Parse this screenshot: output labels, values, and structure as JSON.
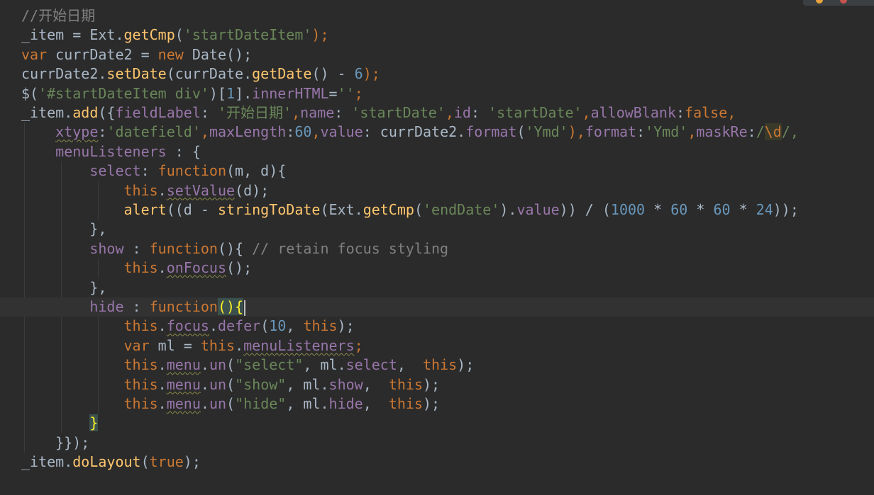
{
  "editor": {
    "lines": [
      {
        "tokens": [
          {
            "t": "//开始日期",
            "c": "comment"
          }
        ]
      },
      {
        "tokens": [
          {
            "t": "_item = Ext.",
            "c": "plain"
          },
          {
            "t": "getCmp",
            "c": "fn"
          },
          {
            "t": "(",
            "c": "plain"
          },
          {
            "t": "'startDateItem'",
            "c": "str"
          },
          {
            "t": ");",
            "c": "kw"
          }
        ]
      },
      {
        "tokens": [
          {
            "t": "var ",
            "c": "kw"
          },
          {
            "t": "currDate2 = ",
            "c": "plain"
          },
          {
            "t": "new ",
            "c": "kw"
          },
          {
            "t": "Date();",
            "c": "plain"
          }
        ]
      },
      {
        "tokens": [
          {
            "t": "currDate2.",
            "c": "plain"
          },
          {
            "t": "setDate",
            "c": "fn"
          },
          {
            "t": "(currDate.",
            "c": "plain"
          },
          {
            "t": "getDate",
            "c": "fn"
          },
          {
            "t": "() - ",
            "c": "plain"
          },
          {
            "t": "6",
            "c": "num"
          },
          {
            "t": ");",
            "c": "kw"
          }
        ]
      },
      {
        "tokens": [
          {
            "t": "$(",
            "c": "plain"
          },
          {
            "t": "'#startDateItem div'",
            "c": "str"
          },
          {
            "t": ")[",
            "c": "plain"
          },
          {
            "t": "1",
            "c": "num"
          },
          {
            "t": "].",
            "c": "plain"
          },
          {
            "t": "innerHTML",
            "c": "prop"
          },
          {
            "t": "=",
            "c": "plain"
          },
          {
            "t": "''",
            "c": "str"
          },
          {
            "t": ";",
            "c": "kw"
          }
        ]
      },
      {
        "tokens": [
          {
            "t": "_item.",
            "c": "plain"
          },
          {
            "t": "add",
            "c": "fn"
          },
          {
            "t": "({",
            "c": "plain"
          },
          {
            "t": "fieldLabel",
            "c": "prop"
          },
          {
            "t": ": ",
            "c": "plain"
          },
          {
            "t": "'开始日期'",
            "c": "str"
          },
          {
            "t": ",",
            "c": "kw"
          },
          {
            "t": "name",
            "c": "prop"
          },
          {
            "t": ": ",
            "c": "plain"
          },
          {
            "t": "'startDate'",
            "c": "str"
          },
          {
            "t": ",",
            "c": "kw"
          },
          {
            "t": "id",
            "c": "prop"
          },
          {
            "t": ": ",
            "c": "plain"
          },
          {
            "t": "'startDate'",
            "c": "str"
          },
          {
            "t": ",",
            "c": "kw"
          },
          {
            "t": "allowBlank",
            "c": "prop"
          },
          {
            "t": ":",
            "c": "plain"
          },
          {
            "t": "false",
            "c": "kw"
          },
          {
            "t": ",",
            "c": "kw"
          }
        ]
      },
      {
        "tokens": [
          {
            "t": "    ",
            "c": "plain"
          },
          {
            "t": "xtype",
            "c": "prop warn"
          },
          {
            "t": ":",
            "c": "plain"
          },
          {
            "t": "'datefield'",
            "c": "str"
          },
          {
            "t": ",",
            "c": "kw"
          },
          {
            "t": "maxLength",
            "c": "prop"
          },
          {
            "t": ":",
            "c": "plain"
          },
          {
            "t": "60",
            "c": "num"
          },
          {
            "t": ",",
            "c": "kw"
          },
          {
            "t": "value",
            "c": "prop"
          },
          {
            "t": ": currDate2.",
            "c": "plain"
          },
          {
            "t": "format",
            "c": "prop"
          },
          {
            "t": "(",
            "c": "plain"
          },
          {
            "t": "'Ymd'",
            "c": "str"
          },
          {
            "t": "),",
            "c": "kw"
          },
          {
            "t": "format",
            "c": "prop"
          },
          {
            "t": ":",
            "c": "plain"
          },
          {
            "t": "'Ymd'",
            "c": "str"
          },
          {
            "t": ",",
            "c": "kw"
          },
          {
            "t": "maskRe",
            "c": "prop"
          },
          {
            "t": ":",
            "c": "plain"
          },
          {
            "t": "/",
            "c": "str"
          },
          {
            "t": "\\d",
            "c": "esc"
          },
          {
            "t": "/,",
            "c": "str"
          }
        ]
      },
      {
        "tokens": [
          {
            "t": "    ",
            "c": "plain"
          },
          {
            "t": "menuListeners",
            "c": "prop"
          },
          {
            "t": " : {",
            "c": "plain"
          }
        ]
      },
      {
        "tokens": [
          {
            "t": "        ",
            "c": "plain"
          },
          {
            "t": "select",
            "c": "prop"
          },
          {
            "t": ": ",
            "c": "plain"
          },
          {
            "t": "function",
            "c": "kw"
          },
          {
            "t": "(m, d){",
            "c": "plain"
          }
        ]
      },
      {
        "tokens": [
          {
            "t": "            ",
            "c": "plain"
          },
          {
            "t": "this",
            "c": "kw"
          },
          {
            "t": ".",
            "c": "plain"
          },
          {
            "t": "setValue",
            "c": "prop warn"
          },
          {
            "t": "(d);",
            "c": "plain"
          }
        ]
      },
      {
        "tokens": [
          {
            "t": "            ",
            "c": "plain"
          },
          {
            "t": "alert",
            "c": "fn"
          },
          {
            "t": "((d - ",
            "c": "plain"
          },
          {
            "t": "stringToDate",
            "c": "fn"
          },
          {
            "t": "(Ext.",
            "c": "plain"
          },
          {
            "t": "getCmp",
            "c": "fn"
          },
          {
            "t": "(",
            "c": "plain"
          },
          {
            "t": "'endDate'",
            "c": "str"
          },
          {
            "t": ").",
            "c": "plain"
          },
          {
            "t": "value",
            "c": "prop"
          },
          {
            "t": ")) / (",
            "c": "plain"
          },
          {
            "t": "1000",
            "c": "num"
          },
          {
            "t": " * ",
            "c": "plain"
          },
          {
            "t": "60",
            "c": "num"
          },
          {
            "t": " * ",
            "c": "plain"
          },
          {
            "t": "60",
            "c": "num"
          },
          {
            "t": " * ",
            "c": "plain"
          },
          {
            "t": "24",
            "c": "num"
          },
          {
            "t": "));",
            "c": "plain"
          }
        ]
      },
      {
        "tokens": [
          {
            "t": "        },",
            "c": "plain"
          }
        ]
      },
      {
        "tokens": [
          {
            "t": "        ",
            "c": "plain"
          },
          {
            "t": "show",
            "c": "prop"
          },
          {
            "t": " : ",
            "c": "plain"
          },
          {
            "t": "function",
            "c": "kw"
          },
          {
            "t": "(){ ",
            "c": "plain"
          },
          {
            "t": "// retain focus styling",
            "c": "comment"
          }
        ]
      },
      {
        "tokens": [
          {
            "t": "            ",
            "c": "plain"
          },
          {
            "t": "this",
            "c": "kw"
          },
          {
            "t": ".",
            "c": "plain"
          },
          {
            "t": "onFocus",
            "c": "prop warn"
          },
          {
            "t": "();",
            "c": "plain"
          }
        ]
      },
      {
        "tokens": [
          {
            "t": "        },",
            "c": "plain"
          }
        ]
      },
      {
        "tokens": [
          {
            "t": "        ",
            "c": "plain"
          },
          {
            "t": "hide",
            "c": "prop"
          },
          {
            "t": " : ",
            "c": "plain"
          },
          {
            "t": "function",
            "c": "kw"
          },
          {
            "t": "()",
            "c": "match"
          },
          {
            "t": "{",
            "c": "match"
          }
        ],
        "current": true
      },
      {
        "tokens": [
          {
            "t": "            ",
            "c": "plain"
          },
          {
            "t": "this",
            "c": "kw"
          },
          {
            "t": ".",
            "c": "plain"
          },
          {
            "t": "focus",
            "c": "prop warn"
          },
          {
            "t": ".",
            "c": "plain"
          },
          {
            "t": "defer",
            "c": "prop"
          },
          {
            "t": "(",
            "c": "plain"
          },
          {
            "t": "10",
            "c": "num"
          },
          {
            "t": ", ",
            "c": "plain"
          },
          {
            "t": "this",
            "c": "kw"
          },
          {
            "t": ");",
            "c": "plain"
          }
        ]
      },
      {
        "tokens": [
          {
            "t": "            ",
            "c": "plain"
          },
          {
            "t": "var ",
            "c": "kw"
          },
          {
            "t": "ml = ",
            "c": "plain"
          },
          {
            "t": "this",
            "c": "kw"
          },
          {
            "t": ".",
            "c": "plain"
          },
          {
            "t": "menuListeners",
            "c": "prop warn"
          },
          {
            "t": ";",
            "c": "kw"
          }
        ]
      },
      {
        "tokens": [
          {
            "t": "            ",
            "c": "plain"
          },
          {
            "t": "this",
            "c": "kw"
          },
          {
            "t": ".",
            "c": "plain"
          },
          {
            "t": "menu",
            "c": "prop warn"
          },
          {
            "t": ".",
            "c": "plain"
          },
          {
            "t": "un",
            "c": "prop"
          },
          {
            "t": "(",
            "c": "plain"
          },
          {
            "t": "\"select\"",
            "c": "str"
          },
          {
            "t": ", ml.",
            "c": "plain"
          },
          {
            "t": "select",
            "c": "prop"
          },
          {
            "t": ",  ",
            "c": "plain"
          },
          {
            "t": "this",
            "c": "kw"
          },
          {
            "t": ");",
            "c": "plain"
          }
        ]
      },
      {
        "tokens": [
          {
            "t": "            ",
            "c": "plain"
          },
          {
            "t": "this",
            "c": "kw"
          },
          {
            "t": ".",
            "c": "plain"
          },
          {
            "t": "menu",
            "c": "prop warn"
          },
          {
            "t": ".",
            "c": "plain"
          },
          {
            "t": "un",
            "c": "prop"
          },
          {
            "t": "(",
            "c": "plain"
          },
          {
            "t": "\"show\"",
            "c": "str"
          },
          {
            "t": ", ml.",
            "c": "plain"
          },
          {
            "t": "show",
            "c": "prop"
          },
          {
            "t": ",  ",
            "c": "plain"
          },
          {
            "t": "this",
            "c": "kw"
          },
          {
            "t": ");",
            "c": "plain"
          }
        ]
      },
      {
        "tokens": [
          {
            "t": "            ",
            "c": "plain"
          },
          {
            "t": "this",
            "c": "kw"
          },
          {
            "t": ".",
            "c": "plain"
          },
          {
            "t": "menu",
            "c": "prop warn"
          },
          {
            "t": ".",
            "c": "plain"
          },
          {
            "t": "un",
            "c": "prop"
          },
          {
            "t": "(",
            "c": "plain"
          },
          {
            "t": "\"hide\"",
            "c": "str"
          },
          {
            "t": ", ml.",
            "c": "plain"
          },
          {
            "t": "hide",
            "c": "prop"
          },
          {
            "t": ",  ",
            "c": "plain"
          },
          {
            "t": "this",
            "c": "kw"
          },
          {
            "t": ");",
            "c": "plain"
          }
        ]
      },
      {
        "tokens": [
          {
            "t": "        ",
            "c": "plain"
          },
          {
            "t": "}",
            "c": "match"
          }
        ]
      },
      {
        "tokens": [
          {
            "t": "    }});",
            "c": "plain"
          }
        ]
      },
      {
        "tokens": [
          {
            "t": "_item.",
            "c": "plain"
          },
          {
            "t": "doLayout",
            "c": "fn"
          },
          {
            "t": "(",
            "c": "plain"
          },
          {
            "t": "true",
            "c": "kw"
          },
          {
            "t": ");",
            "c": "plain"
          }
        ]
      }
    ]
  },
  "colors": {
    "background": "#2b2b2b",
    "current_line": "#323232",
    "keyword": "#cc7832",
    "string": "#6a8759",
    "number": "#6897bb",
    "function": "#ffc66d",
    "property": "#9876aa",
    "comment": "#808080",
    "text": "#a9b7c6"
  }
}
